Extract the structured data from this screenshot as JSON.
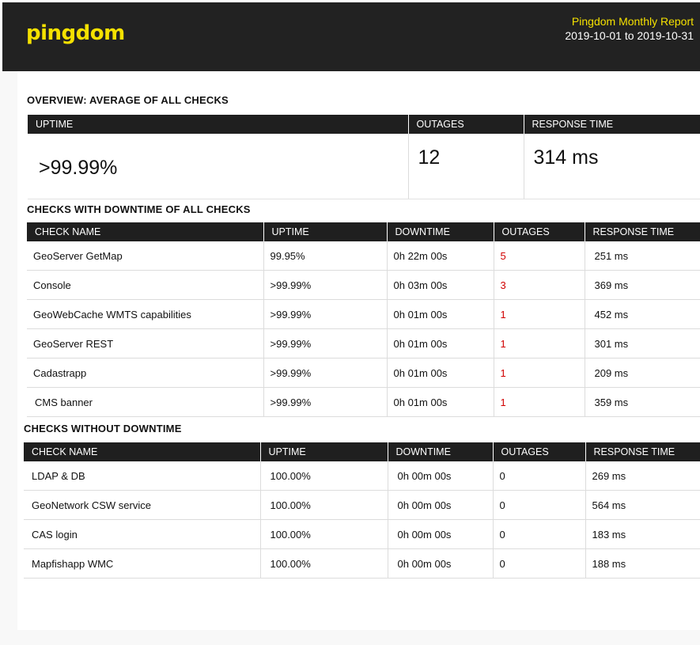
{
  "header": {
    "logo": "pingdom",
    "report_title": "Pingdom Monthly Report",
    "date_range": "2019-10-01 to 2019-10-31"
  },
  "overview": {
    "title": "OVERVIEW: AVERAGE OF ALL CHECKS",
    "columns": [
      "UPTIME",
      "OUTAGES",
      "RESPONSE TIME"
    ],
    "values": [
      ">99.99%",
      "12",
      "314 ms"
    ]
  },
  "with_downtime": {
    "title": "CHECKS  WITH DOWNTIME OF ALL CHECKS",
    "columns": [
      "CHECK NAME",
      "UPTIME",
      "DOWNTIME",
      "OUTAGES",
      "RESPONSE TIME"
    ],
    "rows": [
      [
        "GeoServer GetMap",
        "99.95%",
        "0h 22m 00s",
        "5",
        "251 ms"
      ],
      [
        "Console",
        ">99.99%",
        "0h 03m 00s",
        "3",
        "369 ms"
      ],
      [
        "GeoWebCache WMTS capabilities",
        ">99.99%",
        "0h 01m 00s",
        "1",
        "452 ms"
      ],
      [
        "GeoServer REST",
        ">99.99%",
        "0h 01m 00s",
        "1",
        "301 ms"
      ],
      [
        "Cadastrapp",
        ">99.99%",
        "0h 01m 00s",
        "1",
        "209 ms"
      ],
      [
        "CMS banner",
        ">99.99%",
        "0h 01m 00s",
        "1",
        "359 ms"
      ]
    ]
  },
  "without_downtime": {
    "title": "CHECKS WITHOUT DOWNTIME",
    "columns": [
      "CHECK NAME",
      "UPTIME",
      "DOWNTIME",
      "OUTAGES",
      "RESPONSE TIME"
    ],
    "rows": [
      [
        "LDAP & DB",
        "100.00%",
        "0h 00m 00s",
        "0",
        "269 ms"
      ],
      [
        "GeoNetwork CSW service",
        "100.00%",
        "0h 00m 00s",
        "0",
        "564 ms"
      ],
      [
        "CAS login",
        "100.00%",
        "0h 00m 00s",
        "0",
        "183 ms"
      ],
      [
        "Mapfishapp WMC",
        "100.00%",
        "0h 00m 00s",
        "0",
        "188 ms"
      ]
    ]
  },
  "colors": {
    "accent": "#f5e100",
    "header_bg": "#222222",
    "outage_red": "#d10000"
  }
}
